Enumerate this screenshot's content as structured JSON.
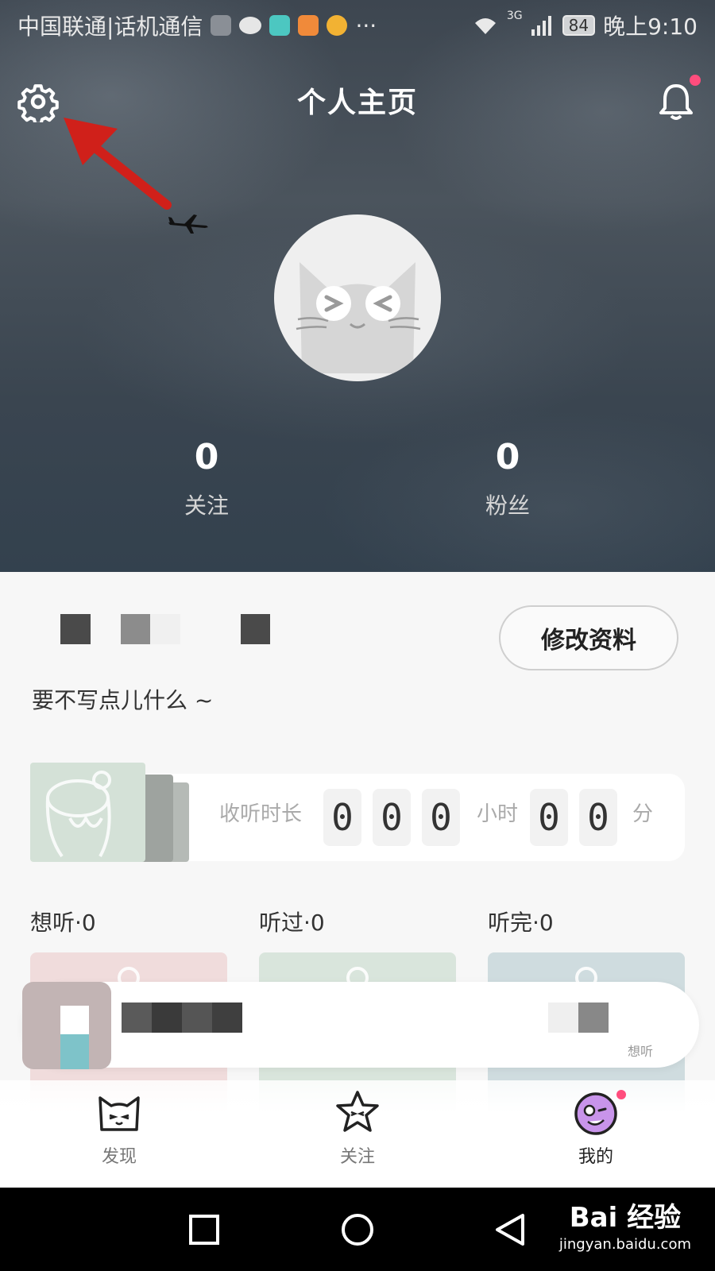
{
  "status_bar": {
    "carrier": "中国联通|话机通信",
    "more": "···",
    "signal_label": "3G",
    "battery": "84",
    "time": "晚上9:10"
  },
  "header": {
    "title": "个人主页"
  },
  "stats": {
    "following_count": "0",
    "following_label": "关注",
    "followers_count": "0",
    "followers_label": "粉丝"
  },
  "profile": {
    "edit_label": "修改资料",
    "bio": "要不写点儿什么 ~"
  },
  "listening": {
    "label": "收听时长",
    "hours_digits": [
      "0",
      "0",
      "0"
    ],
    "hours_unit": "小时",
    "minutes_digits": [
      "0",
      "0"
    ],
    "minutes_unit": "分"
  },
  "shelves": [
    {
      "label": "想听·0",
      "color": "#f0dcdc"
    },
    {
      "label": "听过·0",
      "color": "#d9e5dc"
    },
    {
      "label": "听完·0",
      "color": "#cfdcdf"
    }
  ],
  "mini_player": {
    "hint": "想听"
  },
  "tabs": [
    {
      "label": "发现",
      "icon": "cat-face-icon"
    },
    {
      "label": "关注",
      "icon": "star-face-icon"
    },
    {
      "label": "我的",
      "icon": "wink-face-icon"
    }
  ],
  "watermark": {
    "main": "Bai 经验",
    "sub": "jingyan.baidu.com"
  },
  "colors": {
    "accent_dot": "#ff4d7d",
    "arrow_red": "#d0201a"
  }
}
